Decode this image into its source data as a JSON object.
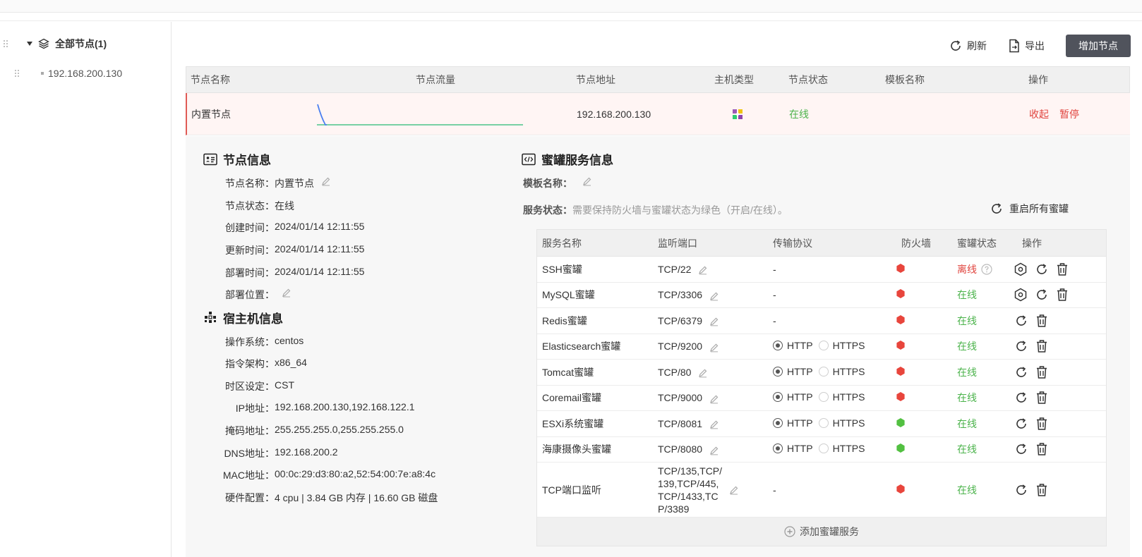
{
  "tree": {
    "root_label": "全部节点(1)",
    "child_label": "192.168.200.130"
  },
  "toolbar": {
    "refresh_label": "刷新",
    "export_label": "导出",
    "add_node_label": "增加节点"
  },
  "node_table": {
    "headers": [
      "节点名称",
      "节点流量",
      "节点地址",
      "主机类型",
      "节点状态",
      "模板名称",
      "操作"
    ],
    "row": {
      "name": "内置节点",
      "address": "192.168.200.130",
      "status": "在线",
      "template": "",
      "action_collapse": "收起",
      "action_pause": "暂停"
    }
  },
  "node_info": {
    "title": "节点信息",
    "fields": [
      {
        "k": "节点名称：",
        "v": "内置节点"
      },
      {
        "k": "节点状态：",
        "v": "在线"
      },
      {
        "k": "创建时间：",
        "v": "2024/01/14 12:11:55"
      },
      {
        "k": "更新时间：",
        "v": "2024/01/14 12:11:55"
      },
      {
        "k": "部署时间：",
        "v": "2024/01/14 12:11:55"
      },
      {
        "k": "部署位置：",
        "v": ""
      }
    ]
  },
  "host_info": {
    "title": "宿主机信息",
    "fields": [
      {
        "k": "操作系统：",
        "v": "centos"
      },
      {
        "k": "指令架构：",
        "v": "x86_64"
      },
      {
        "k": "时区设定：",
        "v": "CST"
      },
      {
        "k": "IP地址：",
        "v": "192.168.200.130,192.168.122.1"
      },
      {
        "k": "掩码地址：",
        "v": "255.255.255.0,255.255.255.0"
      },
      {
        "k": "DNS地址：",
        "v": "192.168.200.2"
      },
      {
        "k": "MAC地址：",
        "v": "00:0c:29:d3:80:a2,52:54:00:7e:a8:4c"
      },
      {
        "k": "硬件配置：",
        "v": "4 cpu | 3.84 GB 内存 | 16.60 GB 磁盘"
      }
    ]
  },
  "honeypot": {
    "title": "蜜罐服务信息",
    "template_label": "模板名称：",
    "status_label": "服务状态：",
    "status_hint": "需要保持防火墙与蜜罐状态为绿色（开启/在线）。",
    "restart_all_label": "重启所有蜜罐",
    "headers": [
      "服务名称",
      "监听端口",
      "传输协议",
      "防火墙",
      "蜜罐状态",
      "操作"
    ],
    "http_label": "HTTP",
    "https_label": "HTTPS",
    "add_service_label": "添加蜜罐服务",
    "colors": {
      "fw_red": "#e8453c",
      "fw_green": "#52c041",
      "online": "#4bb34b",
      "offline": "#e0443e"
    },
    "services": [
      {
        "name": "SSH蜜罐",
        "port": "TCP/22",
        "protocol": "-",
        "firewall": "red",
        "status": "离线"
      },
      {
        "name": "MySQL蜜罐",
        "port": "TCP/3306",
        "protocol": "-",
        "firewall": "red",
        "status": "在线"
      },
      {
        "name": "Redis蜜罐",
        "port": "TCP/6379",
        "protocol": "-",
        "firewall": "red",
        "status": "在线"
      },
      {
        "name": "Elasticsearch蜜罐",
        "port": "TCP/9200",
        "protocol": "HTTP",
        "firewall": "red",
        "status": "在线"
      },
      {
        "name": "Tomcat蜜罐",
        "port": "TCP/80",
        "protocol": "HTTP",
        "firewall": "red",
        "status": "在线"
      },
      {
        "name": "Coremail蜜罐",
        "port": "TCP/9000",
        "protocol": "HTTP",
        "firewall": "red",
        "status": "在线"
      },
      {
        "name": "ESXi系统蜜罐",
        "port": "TCP/8081",
        "protocol": "HTTP",
        "firewall": "green",
        "status": "在线"
      },
      {
        "name": "海康摄像头蜜罐",
        "port": "TCP/8080",
        "protocol": "HTTP",
        "firewall": "green",
        "status": "在线"
      },
      {
        "name": "TCP端口监听",
        "port_lines": [
          "TCP/135,TCP/",
          "139,TCP/445,",
          "TCP/1433,TC",
          "P/3389"
        ],
        "protocol": "-",
        "firewall": "red",
        "status": "在线"
      }
    ]
  }
}
